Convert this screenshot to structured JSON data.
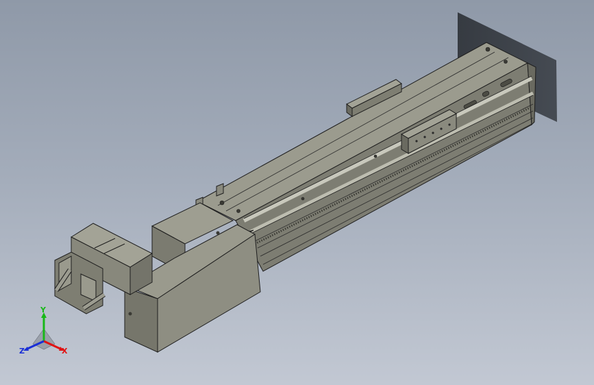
{
  "viewport": {
    "background_top": "#8f99a8",
    "background_bottom": "#c2c8d3",
    "model_color": "#87877a",
    "edge_color": "#1e1e1e"
  },
  "triad": {
    "x_label": "X",
    "y_label": "Y",
    "z_label": "Z",
    "x_color": "#e01414",
    "y_color": "#18b818",
    "z_color": "#1a2fd6"
  }
}
